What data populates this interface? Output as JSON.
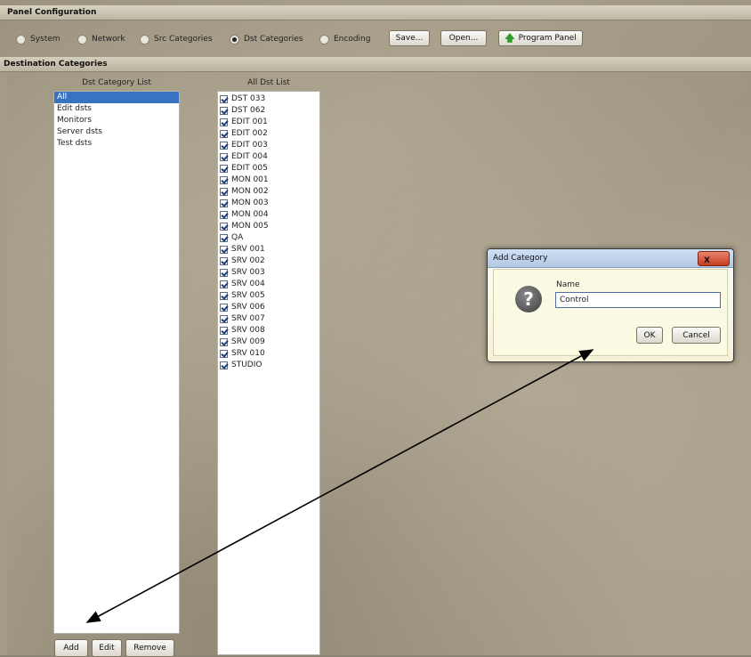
{
  "window": {
    "title": "Panel Configuration"
  },
  "toolbar": {
    "radios": [
      {
        "label": "System",
        "selected": false
      },
      {
        "label": "Network",
        "selected": false
      },
      {
        "label": "Src Categories",
        "selected": false
      },
      {
        "label": "Dst Categories",
        "selected": true
      },
      {
        "label": "Encoding",
        "selected": false
      }
    ],
    "save_label": "Save...",
    "open_label": "Open...",
    "program_label": "Program Panel",
    "program_icon": "up-arrow-icon"
  },
  "section": {
    "title": "Destination Categories"
  },
  "category_list": {
    "header": "Dst Category List",
    "items": [
      "All",
      "Edit dsts",
      "Monitors",
      "Server dsts",
      "Test dsts"
    ],
    "selected": "All"
  },
  "dst_list": {
    "header": "All Dst List",
    "items": [
      "DST 033",
      "DST 062",
      "EDIT 001",
      "EDIT 002",
      "EDIT 003",
      "EDIT 004",
      "EDIT 005",
      "MON 001",
      "MON 002",
      "MON 003",
      "MON 004",
      "MON 005",
      "QA",
      "SRV 001",
      "SRV 002",
      "SRV 003",
      "SRV 004",
      "SRV 005",
      "SRV 006",
      "SRV 007",
      "SRV 008",
      "SRV 009",
      "SRV 010",
      "STUDIO"
    ]
  },
  "buttons": {
    "add": "Add",
    "edit": "Edit",
    "remove": "Remove"
  },
  "dialog": {
    "title": "Add Category",
    "name_label": "Name",
    "name_value": "Control",
    "ok": "OK",
    "cancel": "Cancel",
    "close": "X"
  },
  "colors": {
    "selection": "#3873c2",
    "program_arrow": "#2d9c2d",
    "close_button": "#c63c21"
  }
}
